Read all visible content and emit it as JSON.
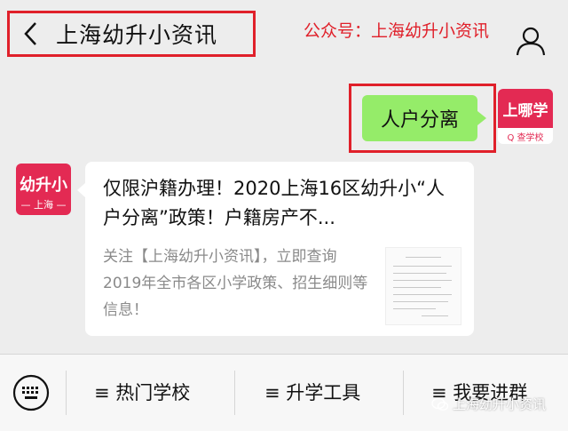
{
  "header": {
    "title": "上海幼升小资讯",
    "promo": "公众号：上海幼升小资讯"
  },
  "messages": {
    "outgoing_text": "人户分离",
    "outgoing_avatar": {
      "top": "上哪学",
      "bottom": "Q 查学校"
    }
  },
  "incoming": {
    "avatar": {
      "big": "幼升小",
      "small": "— 上海 —"
    },
    "article_title": "仅限沪籍办理！2020上海16区幼升小“人户分离”政策！户籍房产不...",
    "article_desc": "关注【上海幼升小资讯】，立即查询2019年全市各区小学政策、招生细则等信息！"
  },
  "bottom_menu": {
    "items": [
      {
        "label": "≡ 热门学校"
      },
      {
        "label": "≡ 升学工具"
      },
      {
        "label": "≡ 我要进群"
      }
    ],
    "watermark": "上海幼升小资讯"
  },
  "colors": {
    "accent_red": "#e0202a",
    "bubble_green": "#95ec69",
    "brand_pink": "#e32a53"
  },
  "icons": [
    "back-arrow-icon",
    "user-icon",
    "keyboard-icon",
    "wechat-icon"
  ]
}
